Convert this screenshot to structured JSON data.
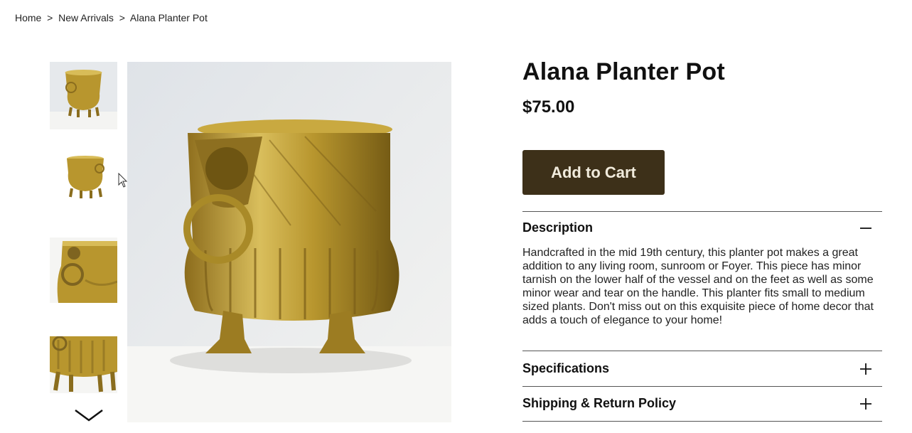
{
  "breadcrumb": {
    "items": [
      "Home",
      "New Arrivals",
      "Alana Planter Pot"
    ],
    "separator": ">"
  },
  "product": {
    "title": "Alana Planter Pot",
    "price": "$75.00",
    "add_to_cart_label": "Add to Cart"
  },
  "accordion": {
    "description": {
      "title": "Description",
      "expanded": true,
      "icon": "minus-icon",
      "body": "Handcrafted in the mid 19th century, this planter pot makes a great addition to any living room, sunroom or Foyer. This piece has minor tarnish on the lower half of the vessel and on the feet as well as some minor wear and tear on the handle. This planter fits small to medium sized plants. Don't miss out on this exquisite piece of home decor that adds a touch of elegance to your home!"
    },
    "specifications": {
      "title": "Specifications",
      "expanded": false,
      "icon": "plus-icon"
    },
    "shipping": {
      "title": "Shipping & Return Policy",
      "expanded": false,
      "icon": "plus-icon"
    }
  },
  "gallery": {
    "thumbnail_count": 4,
    "scroll_icon": "chevron-down-icon"
  },
  "colors": {
    "button_bg": "#3d3019",
    "button_text": "#f1ebdc",
    "brass": "#b8962e"
  }
}
